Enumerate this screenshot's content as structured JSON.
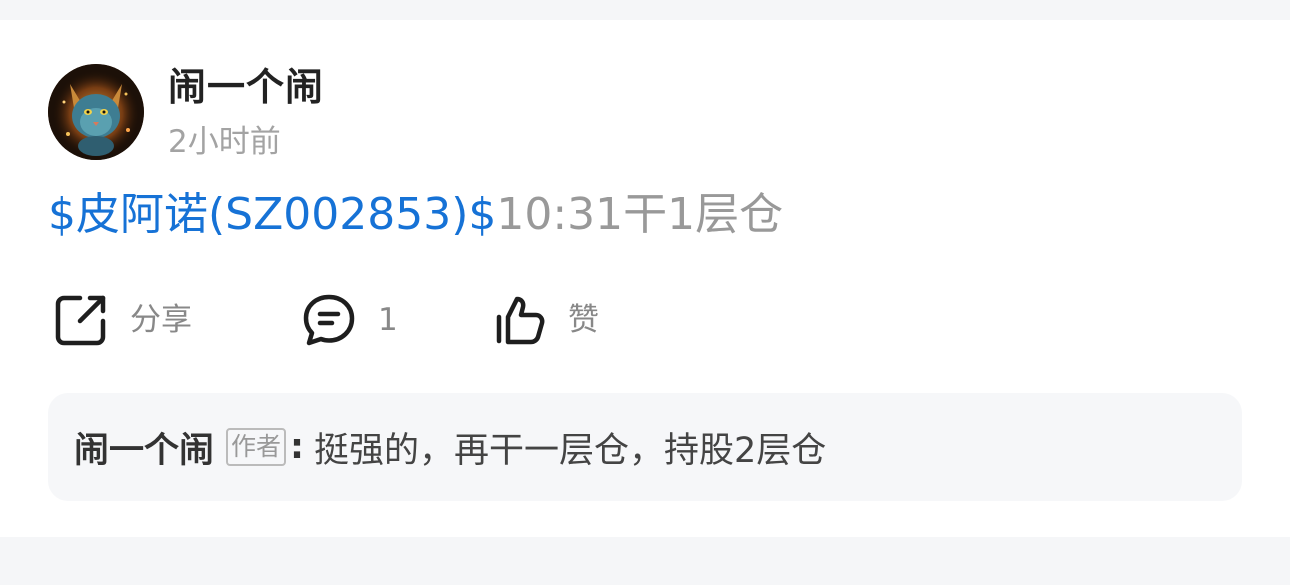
{
  "post": {
    "author": "闹一个闹",
    "time": "2小时前",
    "stock_link": "$皮阿诺(SZ002853)$",
    "content_text": "10:31干1层仓"
  },
  "actions": {
    "share": {
      "icon": "share-icon",
      "label": "分享"
    },
    "comment": {
      "icon": "comment-icon",
      "label": "1"
    },
    "like": {
      "icon": "thumbs-up-icon",
      "label": "赞"
    }
  },
  "comment": {
    "author": "闹一个闹",
    "badge": "作者",
    "colon": ":",
    "text": "挺强的，再干一层仓，持股2层仓"
  },
  "colors": {
    "link": "#1672d6",
    "muted": "#999999",
    "background": "#f5f6f8"
  }
}
